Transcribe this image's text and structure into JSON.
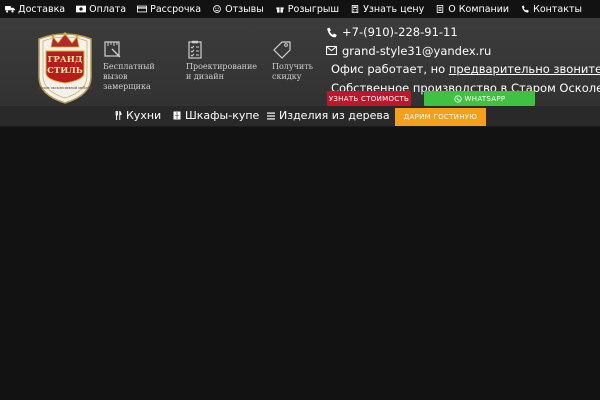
{
  "topbar": {
    "items": [
      {
        "label": "Доставка",
        "icon": "truck-icon"
      },
      {
        "label": "Оплата",
        "icon": "money-icon"
      },
      {
        "label": "Рассрочка",
        "icon": "credit-card-icon"
      },
      {
        "label": "Отзывы",
        "icon": "smile-icon"
      },
      {
        "label": "Розыгрыш",
        "icon": "gift-icon"
      },
      {
        "label": "Узнать цену",
        "icon": "calculator-icon"
      },
      {
        "label": "О Компании",
        "icon": "document-icon"
      },
      {
        "label": "Контакты",
        "icon": "phone-icon"
      }
    ]
  },
  "logo": {
    "line1": "ГРАНД",
    "line2": "СТИЛЬ",
    "tagline": "Салон эксклюзивной мебели"
  },
  "features": [
    {
      "text": "Бесплатный\nвызов\nзамерщика",
      "icon": "measure-icon"
    },
    {
      "text": "Проектирование\nи дизайн",
      "icon": "checklist-icon"
    },
    {
      "text": "Получить\nскидку",
      "icon": "tag-icon"
    }
  ],
  "contacts": {
    "phone": "+7-(910)-228-91-11",
    "email": "grand-style31@yandex.ru",
    "hours_prefix": "Офис работает, но ",
    "hours_link": "предварительно звоните!",
    "production": "Собственное производство в Старом Осколе"
  },
  "buttons": {
    "price": "Узнать стоимость",
    "whatsapp": "WhatsApp"
  },
  "nav": {
    "items": [
      {
        "label": "Кухни",
        "icon": "cutlery-icon"
      },
      {
        "label": "Шкафы-купе",
        "icon": "wardrobe-icon"
      },
      {
        "label": "Изделия из дерева",
        "icon": "menu-icon"
      }
    ],
    "cta": "Дарим гостиную"
  },
  "colors": {
    "accent_red": "#c0152b",
    "accent_green": "#3dc241",
    "accent_orange": "#f3a01b",
    "background": "#121212"
  }
}
